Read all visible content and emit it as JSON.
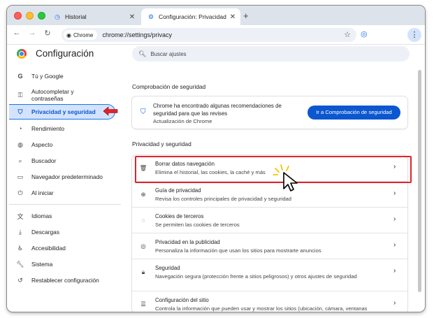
{
  "tabs": [
    {
      "label": "Historial",
      "icon": "history-icon"
    },
    {
      "label": "Configuración: Privacidad y s",
      "icon": "gear-icon"
    }
  ],
  "toolbar": {
    "chip_label": "Chrome",
    "url": "chrome://settings/privacy"
  },
  "header": {
    "title": "Configuración",
    "search_placeholder": "Buscar ajustes"
  },
  "sidebar": {
    "items": [
      {
        "label": "Tú y Google",
        "icon": "google-icon"
      },
      {
        "label": "Autocompletar y contraseñas",
        "icon": "key-icon"
      },
      {
        "label": "Privacidad y seguridad",
        "icon": "shield-icon",
        "active": true
      },
      {
        "label": "Rendimiento",
        "icon": "speedometer-icon"
      },
      {
        "label": "Aspecto",
        "icon": "palette-icon"
      },
      {
        "label": "Buscador",
        "icon": "search-icon"
      },
      {
        "label": "Navegador predeterminado",
        "icon": "browser-icon"
      },
      {
        "label": "Al iniciar",
        "icon": "power-icon"
      },
      {
        "label": "Idiomas",
        "icon": "translate-icon"
      },
      {
        "label": "Descargas",
        "icon": "download-icon"
      },
      {
        "label": "Accesibilidad",
        "icon": "accessibility-icon"
      },
      {
        "label": "Sistema",
        "icon": "wrench-icon"
      },
      {
        "label": "Restablecer configuración",
        "icon": "reset-icon"
      }
    ]
  },
  "safety": {
    "section_title": "Comprobación de seguridad",
    "message": "Chrome ha encontrado algunas recomendaciones de seguridad para que las revises",
    "subtext": "Actualización de Chrome",
    "button": "Ir a Comprobación de seguridad"
  },
  "privacy": {
    "section_title": "Privacidad y seguridad",
    "rows": [
      {
        "title": "Borrar datos navegación",
        "subtitle": "Elimina el historial, las cookies, la caché y más",
        "icon": "trash-icon"
      },
      {
        "title": "Guía de privacidad",
        "subtitle": "Revisa los controles principales de privacidad y seguridad",
        "icon": "compass-icon"
      },
      {
        "title": "Cookies de terceros",
        "subtitle": "Se permiten las cookies de terceros",
        "icon": "cookie-icon"
      },
      {
        "title": "Privacidad en la publicidad",
        "subtitle": "Personaliza la información que usan los sitios para mostrarte anuncios",
        "icon": "ad-privacy-icon"
      },
      {
        "title": "Seguridad",
        "subtitle": "Navegación segura (protección frente a sitios peligrosos) y otros ajustes de seguridad",
        "icon": "lock-icon"
      },
      {
        "title": "Configuración del sitio",
        "subtitle": "Controla la información que pueden usar y mostrar los sitios (ubicación, cámara, ventanas",
        "icon": "sliders-icon"
      }
    ]
  },
  "colors": {
    "accent": "#0b57d0",
    "active_bg": "#d3e3fd",
    "annotation_red": "#e0242b"
  }
}
